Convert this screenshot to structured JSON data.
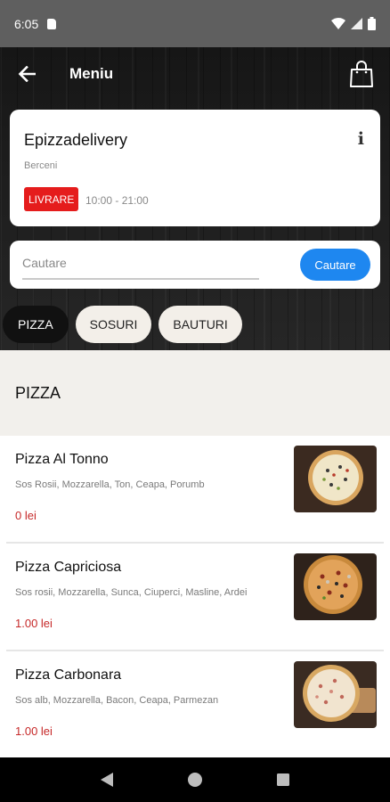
{
  "status_bar": {
    "time": "6:05"
  },
  "app_bar": {
    "title": "Meniu"
  },
  "restaurant": {
    "name": "Epizzadelivery",
    "area": "Berceni",
    "badge": "LIVRARE",
    "hours": "10:00 - 21:00"
  },
  "search": {
    "placeholder": "Cautare",
    "button_label": "Cautare"
  },
  "tabs": [
    {
      "label": "PIZZA",
      "active": true
    },
    {
      "label": "SOSURI",
      "active": false
    },
    {
      "label": "BAUTURI",
      "active": false
    }
  ],
  "section": {
    "title": "PIZZA"
  },
  "products": [
    {
      "name": "Pizza Al Tonno",
      "description": "Sos Rosii, Mozzarella, Ton, Ceapa, Porumb",
      "price": "0 lei",
      "image_icon": "pizza-image"
    },
    {
      "name": "Pizza Capriciosa",
      "description": "Sos rosii, Mozzarella, Sunca, Ciuperci, Masline, Ardei",
      "price": "1.00 lei",
      "image_icon": "pizza-image"
    },
    {
      "name": "Pizza Carbonara",
      "description": "Sos alb, Mozzarella, Bacon, Ceapa, Parmezan",
      "price": "1.00 lei",
      "image_icon": "pizza-image"
    }
  ],
  "colors": {
    "accent": "#1e87f0",
    "badge": "#e51c1c",
    "price": "#c62828",
    "status_bar": "#5f5f5f"
  },
  "icons": [
    "back-arrow-icon",
    "shopping-bag-icon",
    "info-icon",
    "sd-card-icon",
    "wifi-icon",
    "signal-icon",
    "battery-icon",
    "nav-back-icon",
    "nav-home-icon",
    "nav-recents-icon"
  ]
}
